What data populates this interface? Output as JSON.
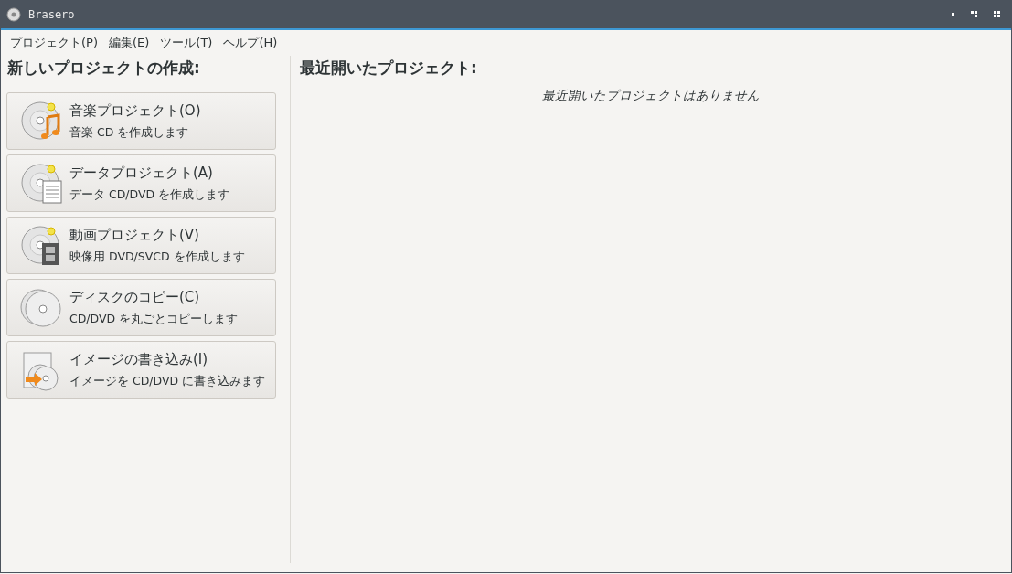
{
  "window": {
    "title": "Brasero"
  },
  "menu": [
    "プロジェクト(P)",
    "編集(E)",
    "ツール(T)",
    "ヘルプ(H)"
  ],
  "new_project": {
    "heading": "新しいプロジェクトの作成:",
    "buttons": [
      {
        "kind": "audio",
        "title": "音楽プロジェクト(O)",
        "subtitle": "音楽 CD を作成します"
      },
      {
        "kind": "data",
        "title": "データプロジェクト(A)",
        "subtitle": "データ CD/DVD を作成します"
      },
      {
        "kind": "video",
        "title": "動画プロジェクト(V)",
        "subtitle": "映像用 DVD/SVCD を作成します"
      },
      {
        "kind": "copy",
        "title": "ディスクのコピー(C)",
        "subtitle": "CD/DVD を丸ごとコピーします"
      },
      {
        "kind": "image",
        "title": "イメージの書き込み(I)",
        "subtitle": "イメージを CD/DVD に書き込みます"
      }
    ]
  },
  "recent": {
    "heading": "最近開いたプロジェクト:",
    "empty_message": "最近開いたプロジェクトはありません"
  }
}
